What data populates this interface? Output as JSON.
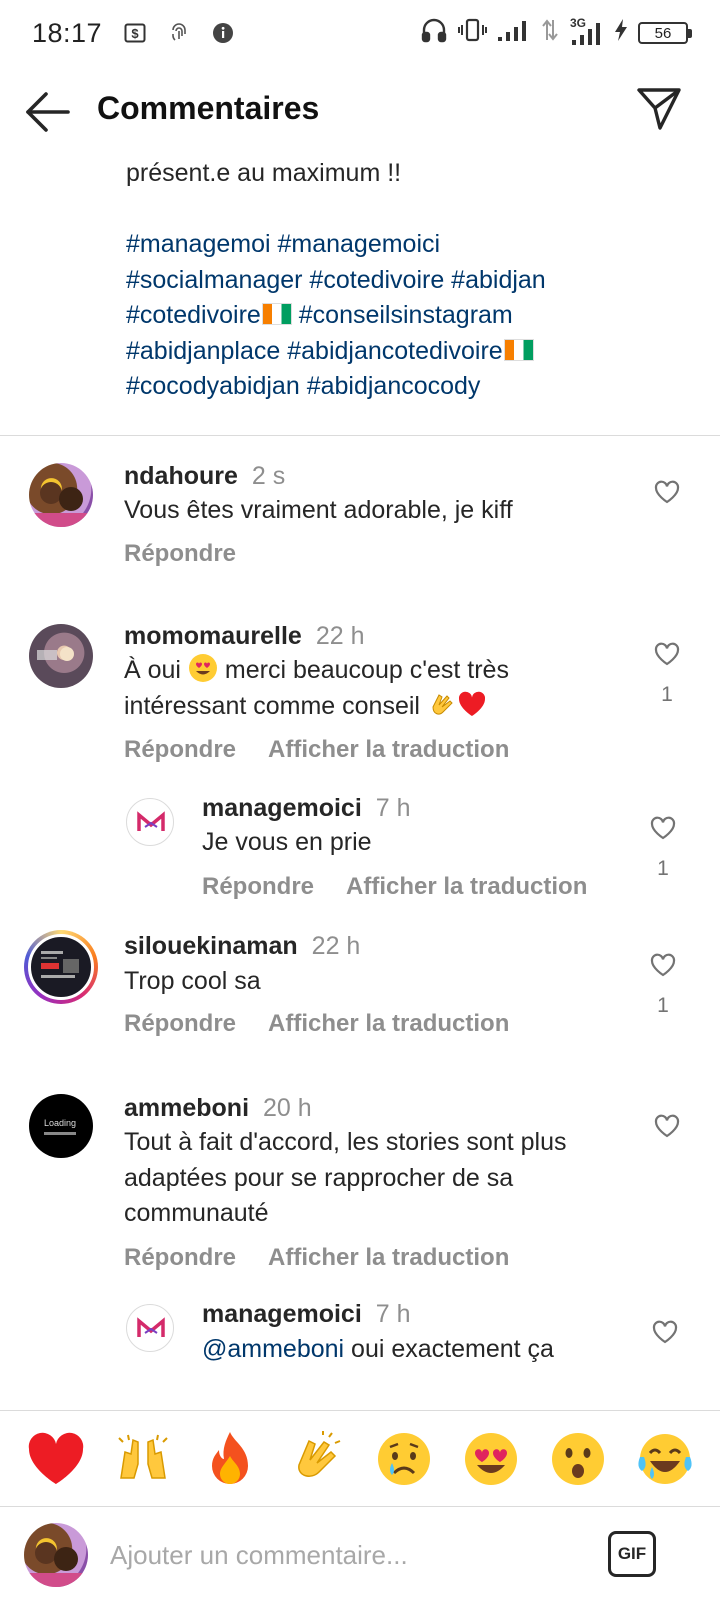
{
  "status_bar": {
    "time": "18:17",
    "network": "3G",
    "battery": "56",
    "left_icons": [
      "dollar-box-icon",
      "fingerprint-icon",
      "info-icon"
    ],
    "right_icons": [
      "headphones-icon",
      "vibrate-icon",
      "signal-icon",
      "data-arrows-icon",
      "signal-3g-icon",
      "charging-icon",
      "battery-icon"
    ]
  },
  "header": {
    "title": "Commentaires"
  },
  "caption": {
    "line": "présent.e au maximum !!",
    "hashtags": [
      "#managemoi #managemoici",
      "#socialmanager #cotedivoire #abidjan",
      "#cotedivoire",
      " #conseilsinstagram",
      "#abidjanplace #abidjancotedivoire",
      "#cocodyabidjan #abidjancocody"
    ]
  },
  "common": {
    "reply": "Répondre",
    "translate": "Afficher la traduction"
  },
  "comments": [
    {
      "username": "ndahoure",
      "time": "2 s",
      "text": "Vous êtes vraiment adorable, je kiff",
      "likes": ""
    },
    {
      "username": "momomaurelle",
      "time": "22 h",
      "text_a": "À oui",
      "text_b": " merci beaucoup c'est très",
      "text_c": "intéressant comme conseil ",
      "likes": "1"
    },
    {
      "username": "managemoici",
      "time": "7 h",
      "text": "Je vous en prie",
      "likes": "1"
    },
    {
      "username": "silouekinaman",
      "time": "22 h",
      "text": "Trop cool sa",
      "likes": "1"
    },
    {
      "username": "ammeboni",
      "time": "20 h",
      "text_lines": [
        "Tout à fait d'accord, les stories sont plus",
        "adaptées pour se rapprocher de sa",
        "communauté"
      ],
      "likes": "",
      "avatar_text": "Loading"
    },
    {
      "username": "managemoici",
      "time": "7 h",
      "mention": "@ammeboni",
      "text": " oui exactement ça",
      "likes": ""
    }
  ],
  "emoji_bar": [
    "red-heart",
    "raising-hands",
    "fire",
    "clapping-hands",
    "crying-face",
    "heart-eyes-face",
    "astonished-face",
    "tears-of-joy-face"
  ],
  "composer": {
    "placeholder": "Ajouter un commentaire...",
    "gif_label": "GIF"
  },
  "colors": {
    "hashtag": "#00376b",
    "secondary_text": "#8e8e8e",
    "divider": "#dbdbdb",
    "heart_red": "#ed1c24"
  }
}
